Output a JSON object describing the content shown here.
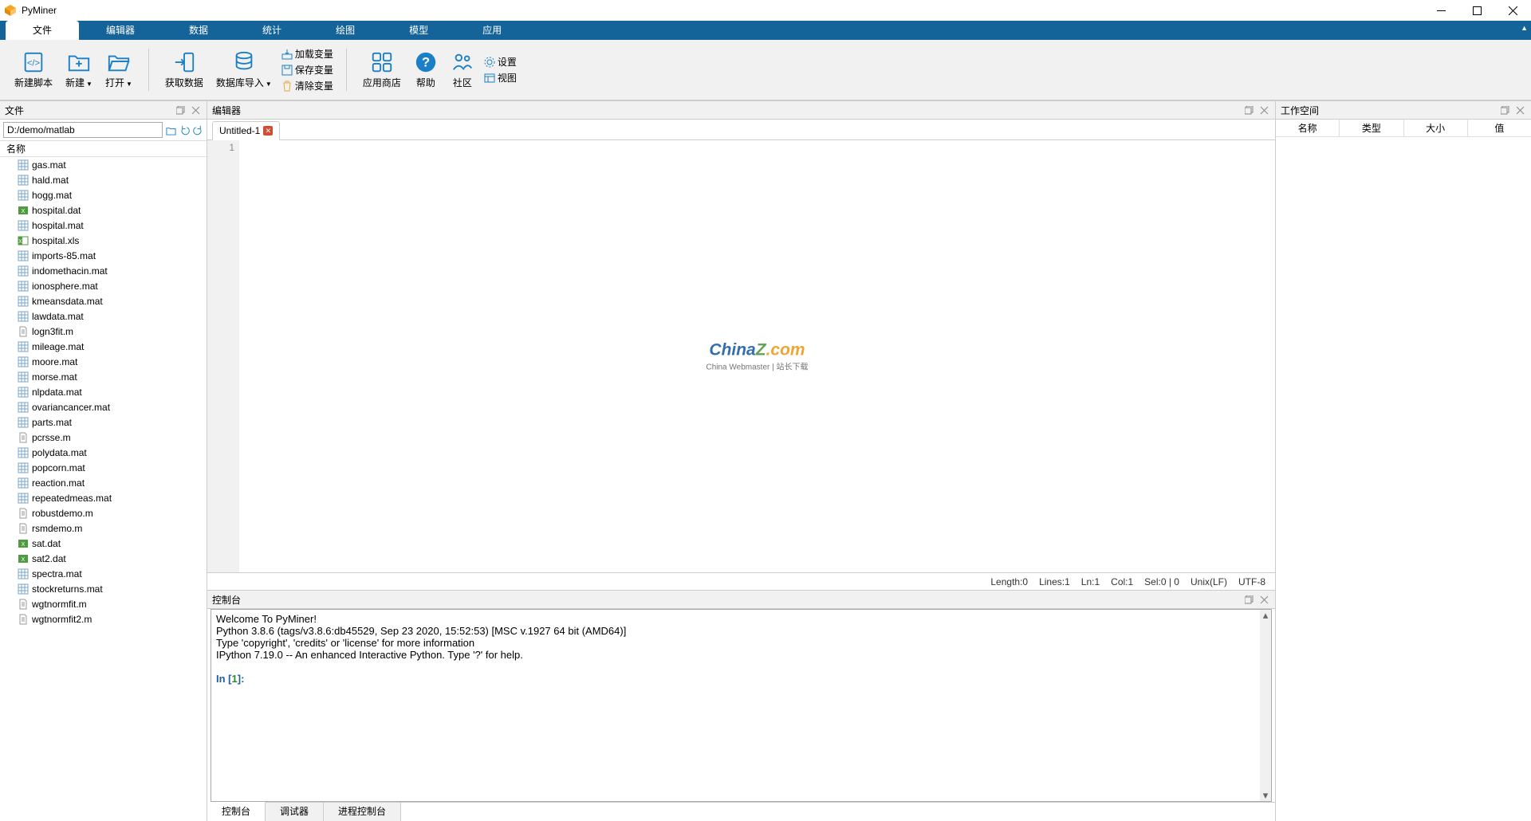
{
  "title": "PyMiner",
  "ribbon": {
    "tabs": [
      "文件",
      "编辑器",
      "数据",
      "统计",
      "绘图",
      "模型",
      "应用"
    ],
    "active_index": 0
  },
  "toolbar": {
    "new_script": "新建脚本",
    "new_btn": "新建",
    "open_btn": "打开",
    "get_data": "获取数据",
    "db_import": "数据库导入",
    "load_var": "加载变量",
    "save_var": "保存变量",
    "clear_var": "清除变量",
    "app_store": "应用商店",
    "help": "帮助",
    "community": "社区",
    "settings": "设置",
    "view": "视图"
  },
  "left": {
    "title": "文件",
    "path": "D:/demo/matlab",
    "col_name": "名称",
    "files": [
      {
        "name": "gas.mat",
        "type": "grid"
      },
      {
        "name": "hald.mat",
        "type": "grid"
      },
      {
        "name": "hogg.mat",
        "type": "grid"
      },
      {
        "name": "hospital.dat",
        "type": "xls"
      },
      {
        "name": "hospital.mat",
        "type": "grid"
      },
      {
        "name": "hospital.xls",
        "type": "xlsg"
      },
      {
        "name": "imports-85.mat",
        "type": "grid"
      },
      {
        "name": "indomethacin.mat",
        "type": "grid"
      },
      {
        "name": "ionosphere.mat",
        "type": "grid"
      },
      {
        "name": "kmeansdata.mat",
        "type": "grid"
      },
      {
        "name": "lawdata.mat",
        "type": "grid"
      },
      {
        "name": "logn3fit.m",
        "type": "doc"
      },
      {
        "name": "mileage.mat",
        "type": "grid"
      },
      {
        "name": "moore.mat",
        "type": "grid"
      },
      {
        "name": "morse.mat",
        "type": "grid"
      },
      {
        "name": "nlpdata.mat",
        "type": "grid"
      },
      {
        "name": "ovariancancer.mat",
        "type": "grid"
      },
      {
        "name": "parts.mat",
        "type": "grid"
      },
      {
        "name": "pcrsse.m",
        "type": "doc"
      },
      {
        "name": "polydata.mat",
        "type": "grid"
      },
      {
        "name": "popcorn.mat",
        "type": "grid"
      },
      {
        "name": "reaction.mat",
        "type": "grid"
      },
      {
        "name": "repeatedmeas.mat",
        "type": "grid"
      },
      {
        "name": "robustdemo.m",
        "type": "doc"
      },
      {
        "name": "rsmdemo.m",
        "type": "doc"
      },
      {
        "name": "sat.dat",
        "type": "xls"
      },
      {
        "name": "sat2.dat",
        "type": "xls"
      },
      {
        "name": "spectra.mat",
        "type": "grid"
      },
      {
        "name": "stockreturns.mat",
        "type": "grid"
      },
      {
        "name": "wgtnormfit.m",
        "type": "doc"
      },
      {
        "name": "wgtnormfit2.m",
        "type": "doc"
      }
    ]
  },
  "editor": {
    "title": "编辑器",
    "tab": "Untitled-1",
    "line_no": "1",
    "status": {
      "length": "Length:0",
      "lines": "Lines:1",
      "ln": "Ln:1",
      "col": "Col:1",
      "sel": "Sel:0 | 0",
      "eol": "Unix(LF)",
      "enc": "UTF-8"
    }
  },
  "console": {
    "title": "控制台",
    "text1": "Welcome To PyMiner!",
    "text2": "Python 3.8.6 (tags/v3.8.6:db45529, Sep 23 2020, 15:52:53) [MSC v.1927 64 bit (AMD64)]",
    "text3": "Type 'copyright', 'credits' or 'license' for more information",
    "text4": "IPython 7.19.0 -- An enhanced Interactive Python. Type '?' for help.",
    "prompt_in": "In [",
    "prompt_num": "1",
    "prompt_end": "]:",
    "tabs": [
      "控制台",
      "调试器",
      "进程控制台"
    ],
    "active_tab": 0
  },
  "workspace": {
    "title": "工作空间",
    "cols": [
      "名称",
      "类型",
      "大小",
      "值"
    ]
  },
  "watermark": {
    "line1a": "China",
    "line1b": "Z",
    "line1c": ".com",
    "line2": "China Webmaster | 站长下载"
  }
}
